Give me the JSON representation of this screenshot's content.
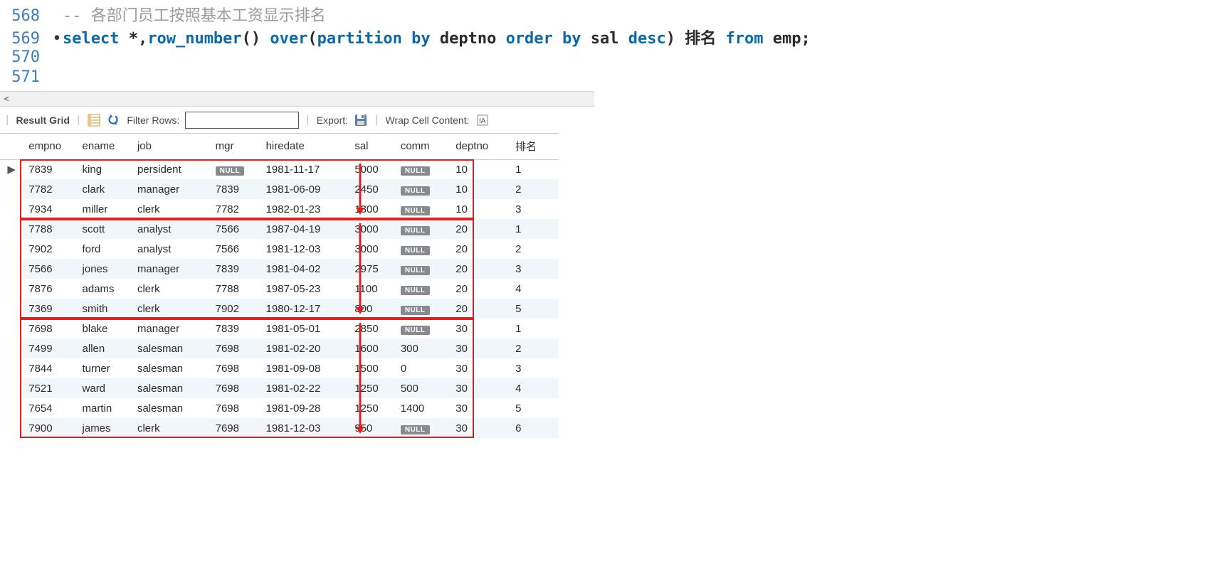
{
  "code": {
    "lines": [
      {
        "num": "568",
        "bullet": "",
        "tokens": [
          [
            "comment",
            "-- 各部门员工按照基本工资显示排名"
          ]
        ]
      },
      {
        "num": "569",
        "bullet": "•",
        "tokens": [
          [
            "keyword",
            "select "
          ],
          [
            "plain",
            "*,"
          ],
          [
            "func",
            "row_number"
          ],
          [
            "paren",
            "() "
          ],
          [
            "keyword",
            "over"
          ],
          [
            "paren",
            "("
          ],
          [
            "keyword",
            "partition by "
          ],
          [
            "ident",
            "deptno "
          ],
          [
            "keyword",
            "order by "
          ],
          [
            "ident",
            "sal "
          ],
          [
            "keyword",
            "desc"
          ],
          [
            "paren",
            ") "
          ],
          [
            "ident",
            "排名 "
          ],
          [
            "keyword",
            "from "
          ],
          [
            "ident",
            "emp"
          ],
          [
            "plain",
            ";"
          ]
        ]
      },
      {
        "num": "570",
        "bullet": "",
        "tokens": []
      },
      {
        "num": "571",
        "bullet": "",
        "tokens": []
      }
    ]
  },
  "toolbar": {
    "result_grid": "Result Grid",
    "filter_rows": "Filter Rows:",
    "filter_value": "",
    "export": "Export:",
    "wrap_cell": "Wrap Cell Content:"
  },
  "grid": {
    "columns": [
      "empno",
      "ename",
      "job",
      "mgr",
      "hiredate",
      "sal",
      "comm",
      "deptno",
      "排名"
    ],
    "current_row_indicator": "▶",
    "null_label": "NULL",
    "rows": [
      {
        "empno": "7839",
        "ename": "king",
        "job": "persident",
        "mgr": null,
        "hiredate": "1981-11-17",
        "sal": "5000",
        "comm": null,
        "deptno": "10",
        "排名": "1",
        "current": true
      },
      {
        "empno": "7782",
        "ename": "clark",
        "job": "manager",
        "mgr": "7839",
        "hiredate": "1981-06-09",
        "sal": "2450",
        "comm": null,
        "deptno": "10",
        "排名": "2"
      },
      {
        "empno": "7934",
        "ename": "miller",
        "job": "clerk",
        "mgr": "7782",
        "hiredate": "1982-01-23",
        "sal": "1300",
        "comm": null,
        "deptno": "10",
        "排名": "3"
      },
      {
        "empno": "7788",
        "ename": "scott",
        "job": "analyst",
        "mgr": "7566",
        "hiredate": "1987-04-19",
        "sal": "3000",
        "comm": null,
        "deptno": "20",
        "排名": "1"
      },
      {
        "empno": "7902",
        "ename": "ford",
        "job": "analyst",
        "mgr": "7566",
        "hiredate": "1981-12-03",
        "sal": "3000",
        "comm": null,
        "deptno": "20",
        "排名": "2"
      },
      {
        "empno": "7566",
        "ename": "jones",
        "job": "manager",
        "mgr": "7839",
        "hiredate": "1981-04-02",
        "sal": "2975",
        "comm": null,
        "deptno": "20",
        "排名": "3"
      },
      {
        "empno": "7876",
        "ename": "adams",
        "job": "clerk",
        "mgr": "7788",
        "hiredate": "1987-05-23",
        "sal": "1100",
        "comm": null,
        "deptno": "20",
        "排名": "4"
      },
      {
        "empno": "7369",
        "ename": "smith",
        "job": "clerk",
        "mgr": "7902",
        "hiredate": "1980-12-17",
        "sal": "800",
        "comm": null,
        "deptno": "20",
        "排名": "5"
      },
      {
        "empno": "7698",
        "ename": "blake",
        "job": "manager",
        "mgr": "7839",
        "hiredate": "1981-05-01",
        "sal": "2850",
        "comm": null,
        "deptno": "30",
        "排名": "1"
      },
      {
        "empno": "7499",
        "ename": "allen",
        "job": "salesman",
        "mgr": "7698",
        "hiredate": "1981-02-20",
        "sal": "1600",
        "comm": "300",
        "deptno": "30",
        "排名": "2"
      },
      {
        "empno": "7844",
        "ename": "turner",
        "job": "salesman",
        "mgr": "7698",
        "hiredate": "1981-09-08",
        "sal": "1500",
        "comm": "0",
        "deptno": "30",
        "排名": "3"
      },
      {
        "empno": "7521",
        "ename": "ward",
        "job": "salesman",
        "mgr": "7698",
        "hiredate": "1981-02-22",
        "sal": "1250",
        "comm": "500",
        "deptno": "30",
        "排名": "4"
      },
      {
        "empno": "7654",
        "ename": "martin",
        "job": "salesman",
        "mgr": "7698",
        "hiredate": "1981-09-28",
        "sal": "1250",
        "comm": "1400",
        "deptno": "30",
        "排名": "5"
      },
      {
        "empno": "7900",
        "ename": "james",
        "job": "clerk",
        "mgr": "7698",
        "hiredate": "1981-12-03",
        "sal": "950",
        "comm": null,
        "deptno": "30",
        "排名": "6"
      }
    ],
    "groups": [
      {
        "start": 0,
        "end": 2
      },
      {
        "start": 3,
        "end": 7
      },
      {
        "start": 8,
        "end": 13
      }
    ]
  }
}
